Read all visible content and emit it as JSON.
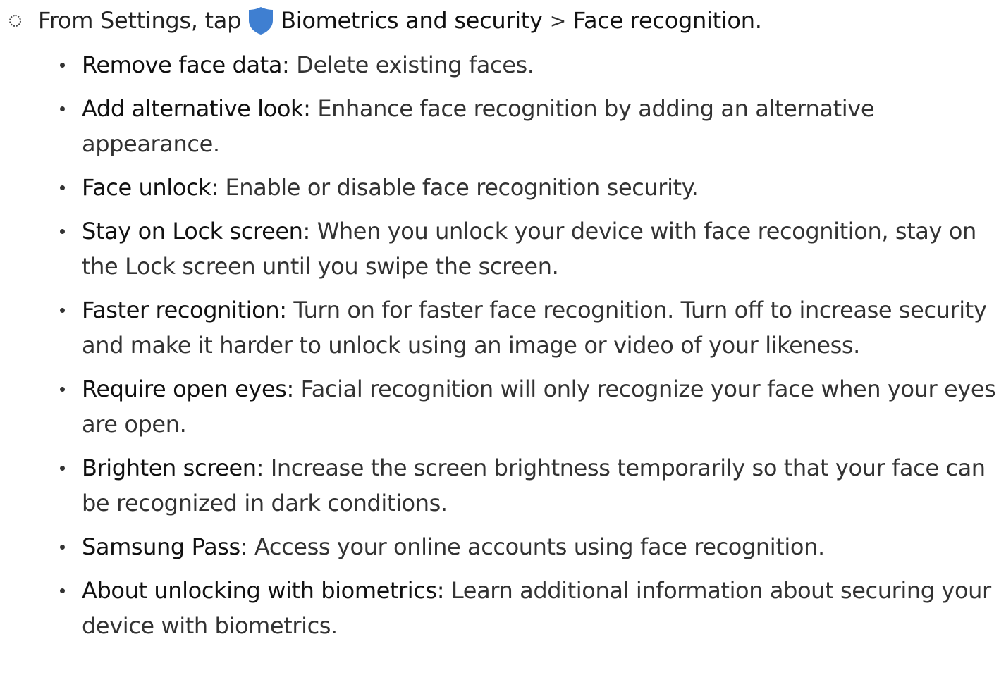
{
  "step": {
    "prefix": "From Settings, tap",
    "menu_item": "Biometrics and security",
    "separator": ">",
    "submenu_item": "Face recognition",
    "suffix": ".",
    "icon": "shield-icon",
    "icon_color": "#3f7fd1"
  },
  "options": [
    {
      "term": "Remove face data",
      "sep": ": ",
      "desc": "Delete existing faces."
    },
    {
      "term": "Add alternative look",
      "sep": ": ",
      "desc": "Enhance face recognition by adding an alternative appearance."
    },
    {
      "term": "Face unlock",
      "sep": ": ",
      "desc": "Enable or disable face recognition security."
    },
    {
      "term": "Stay on Lock screen",
      "sep": ": ",
      "desc": "When you unlock your device with face recognition, stay on the Lock screen until you swipe the screen."
    },
    {
      "term": "Faster recognition",
      "sep": ": ",
      "desc": "Turn on for faster face recognition. Turn off to increase security and make it harder to unlock using an image or video of your likeness."
    },
    {
      "term": "Require open eyes",
      "sep": ": ",
      "desc": "Facial recognition will only recognize your face when your eyes are open."
    },
    {
      "term": "Brighten screen",
      "sep": ": ",
      "desc": "Increase the screen brightness temporarily so that your face can be recognized in dark conditions."
    },
    {
      "term": "Samsung Pass",
      "sep": ": ",
      "desc": "Access your online accounts using face recognition."
    },
    {
      "term": "About unlocking with biometrics",
      "sep": ": ",
      "desc": "Learn additional information about securing your device with biometrics."
    }
  ]
}
